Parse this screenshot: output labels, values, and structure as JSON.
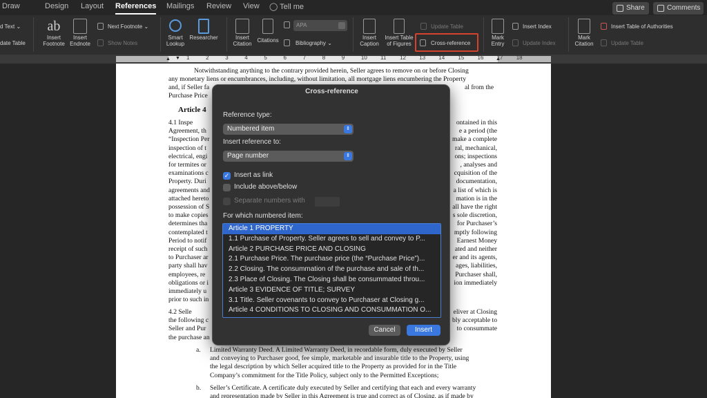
{
  "tabs": [
    "Draw",
    "Design",
    "Layout",
    "References",
    "Mailings",
    "Review",
    "View",
    "Tell me"
  ],
  "active_tab": "References",
  "top_buttons": {
    "share": "Share",
    "comments": "Comments"
  },
  "ribbon": {
    "text_label": "d Text",
    "update_table_left": "date Table",
    "insert_footnote": [
      "Insert",
      "Footnote"
    ],
    "insert_endnote": [
      "Insert",
      "Endnote"
    ],
    "next_footnote": "Next Footnote",
    "show_notes": "Show Notes",
    "smart_lookup": [
      "Smart",
      "Lookup"
    ],
    "researcher": "Researcher",
    "insert_citation": [
      "Insert",
      "Citation"
    ],
    "citations": "Citations",
    "style_value": "APA",
    "bibliography": "Bibliography",
    "insert_caption": [
      "Insert",
      "Caption"
    ],
    "insert_table_of_figures": [
      "Insert Table",
      "of Figures"
    ],
    "update_table": "Update Table",
    "cross_reference": "Cross-reference",
    "mark_entry": [
      "Mark",
      "Entry"
    ],
    "insert_index": "Insert Index",
    "update_index": "Update Index",
    "mark_citation": [
      "Mark",
      "Citation"
    ],
    "insert_table_of_authorities": "Insert Table of Authorities",
    "update_table_authorities": "Update Table"
  },
  "ruler_numbers": [
    "1",
    "2",
    "3",
    "4",
    "5",
    "6",
    "7",
    "8",
    "9",
    "10",
    "11",
    "12",
    "13",
    "14",
    "15",
    "16",
    "17",
    "18"
  ],
  "document": {
    "p1": [
      "Notwithstanding anything to the contrary provided herein, Seller agrees to remove on or before Closing",
      "any monetary liens or encumbrances, including, without limitation, all mortgage liens encumbering the Property",
      "and, if Seller fa",
      "Purchase Price"
    ],
    "p1_right_fragment": "al from the",
    "heading": "Article 4",
    "s41_left": [
      "4.1    Inspe",
      "Agreement, th",
      "“Inspection Per",
      "inspection of t",
      "electrical, engi",
      "for termites or",
      "examinations c",
      "Property. Duri",
      "agreements and",
      "attached hereto",
      "possession of S",
      "to make copies",
      "determines tha",
      "contemplated t",
      "Period to notif",
      "receipt of such",
      "to Purchaser ar",
      "party shall hav",
      "employees, re",
      "obligations or i",
      "immediately u",
      "prior to such in"
    ],
    "s41_right": [
      "ontained in this",
      "e a period (the",
      "make a complete",
      "ral, mechanical,",
      "ons; inspections",
      ", analyses and",
      "cquisition of the",
      "documentation,",
      "a list of which is",
      "mation is in the",
      "all have the right",
      "s sole discretion,",
      "for Purchaser’s",
      "mptly following",
      "Earnest Money",
      "ated and neither",
      "er and its agents,",
      "ages, liabilities,",
      "Purchaser shall,",
      "ion immediately"
    ],
    "s42_left": [
      "4.2    Selle",
      "the following c",
      "Seller and Pur",
      "the purchase an"
    ],
    "s42_right": [
      "eliver at Closing",
      "bly acceptable to",
      "to consummate"
    ],
    "item_a_marker": "a.",
    "item_a": [
      "Limited Warranty Deed. A Limited Warranty Deed, in recordable form, duly executed by Seller",
      "and conveying to Purchaser good, fee simple, marketable and insurable title to the Property, using",
      "the legal description by which Seller acquired title to the Property as provided for in the Title",
      "Company’s commitment for the Title Policy, subject only to the Permitted Exceptions;"
    ],
    "item_b_marker": "b.",
    "item_b": [
      "Seller’s Certificate. A certificate duly executed by Seller and certifying that each and every warranty",
      "and representation made by Seller in this Agreement is true and correct as of Closing, as if made by"
    ]
  },
  "dialog": {
    "title": "Cross-reference",
    "reference_type_label": "Reference type:",
    "reference_type_value": "Numbered item",
    "insert_reference_to_label": "Insert reference to:",
    "insert_reference_to_value": "Page number",
    "insert_as_link": "Insert as link",
    "insert_as_link_checked": true,
    "include_above_below": "Include above/below",
    "separate_numbers_with": "Separate numbers with",
    "for_which_label": "For which numbered item:",
    "items": [
      "Article 1 PROPERTY",
      "1.1 Purchase of Property. Seller agrees to sell and convey to P...",
      "Article 2 PURCHASE PRICE AND CLOSING",
      "2.1 Purchase Price. The purchase price (the “Purchase Price”)...",
      "2.2 Closing. The consummation of the purchase and sale of th...",
      "2.3 Place of Closing. The Closing shall be consummated throu...",
      "Article 3 EVIDENCE OF TITLE; SURVEY",
      "3.1 Title. Seller covenants to convey to Purchaser at Closing g...",
      "Article 4 CONDITIONS TO CLOSING AND CONSUMMATION O..."
    ],
    "selected_index": 0,
    "cancel": "Cancel",
    "insert": "Insert"
  },
  "colors": {
    "accent": "#3a78e0",
    "highlight_box": "#d6422c"
  }
}
